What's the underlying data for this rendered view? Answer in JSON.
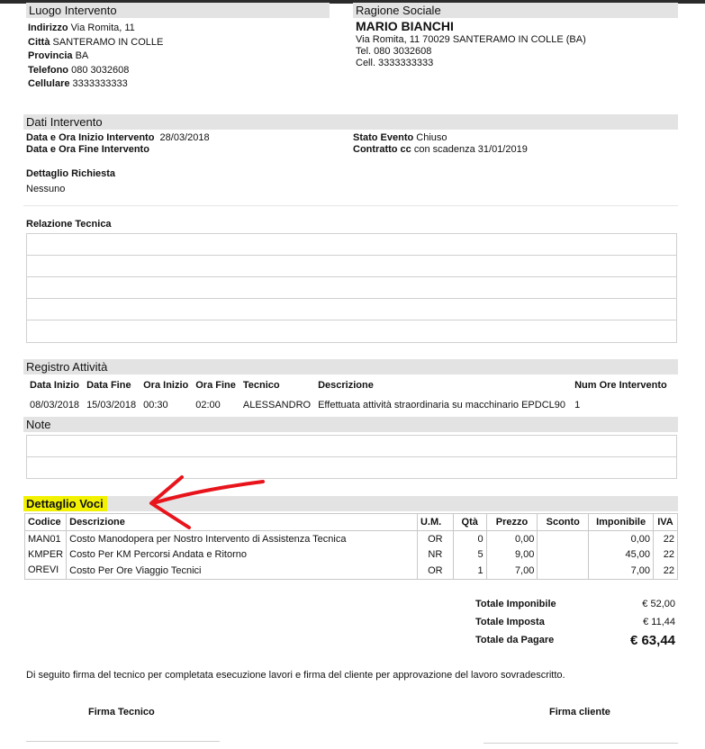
{
  "luogo": {
    "header": "Luogo Intervento",
    "rows": [
      {
        "label": "Indirizzo",
        "value": "Via Romita, 11"
      },
      {
        "label": "Città",
        "value": "SANTERAMO IN COLLE"
      },
      {
        "label": "Provincia",
        "value": "BA"
      },
      {
        "label": "Telefono",
        "value": "080 3032608"
      },
      {
        "label": "Cellulare",
        "value": "3333333333"
      }
    ]
  },
  "ragione": {
    "header": "Ragione Sociale",
    "name": "MARIO BIANCHI",
    "address": "Via Romita, 11 70029 SANTERAMO IN COLLE (BA)",
    "tel": "Tel. 080 3032608",
    "cell": "Cell. 3333333333"
  },
  "dati": {
    "header": "Dati Intervento",
    "inizio_label": "Data e Ora Inizio Intervento",
    "inizio_value": "28/03/2018",
    "fine_label": "Data e Ora Fine Intervento",
    "stato_label": "Stato Evento",
    "stato_value": "Chiuso",
    "contratto_label": "Contratto cc",
    "contratto_value": "con scadenza 31/01/2019",
    "dettaglio_label": "Dettaglio Richiesta",
    "dettaglio_value": "Nessuno",
    "relazione_label": "Relazione Tecnica"
  },
  "registro": {
    "header": "Registro Attività",
    "columns": [
      "Data Inizio",
      "Data Fine",
      "Ora Inizio",
      "Ora Fine",
      "Tecnico",
      "Descrizione",
      "Num Ore Intervento"
    ],
    "rows": [
      [
        "08/03/2018",
        "15/03/2018",
        "00:30",
        "02:00",
        "ALESSANDRO",
        "Effettuata attività straordinaria su macchinario EPDCL90",
        "1"
      ]
    ]
  },
  "note": {
    "header": "Note"
  },
  "voci": {
    "header": "Dettaglio Voci",
    "columns": [
      "Codice",
      "Descrizione",
      "U.M.",
      "Qtà",
      "Prezzo",
      "Sconto",
      "Imponibile",
      "IVA"
    ],
    "rows": [
      [
        "MAN01",
        "Costo Manodopera per Nostro Intervento di Assistenza Tecnica",
        "OR",
        "0",
        "0,00",
        "",
        "0,00",
        "22"
      ],
      [
        "KMPER",
        "Costo Per KM Percorsi Andata e Ritorno",
        "NR",
        "5",
        "9,00",
        "",
        "45,00",
        "22"
      ],
      [
        "OREVI",
        "Costo Per Ore Viaggio Tecnici",
        "OR",
        "1",
        "7,00",
        "",
        "7,00",
        "22"
      ]
    ]
  },
  "totali": {
    "imponibile_label": "Totale Imponibile",
    "imponibile_value": "€ 52,00",
    "imposta_label": "Totale Imposta",
    "imposta_value": "€ 11,44",
    "pagare_label": "Totale da Pagare",
    "pagare_value": "€ 63,44"
  },
  "footer": {
    "text": "Di seguito firma del tecnico per completata esecuzione lavori e firma del cliente per approvazione del lavoro sovradescritto.",
    "firma_tecnico": "Firma Tecnico",
    "firma_cliente": "Firma cliente"
  },
  "annotation": {
    "arrow_color": "#e8141b",
    "highlight_color": "#f2f200"
  }
}
